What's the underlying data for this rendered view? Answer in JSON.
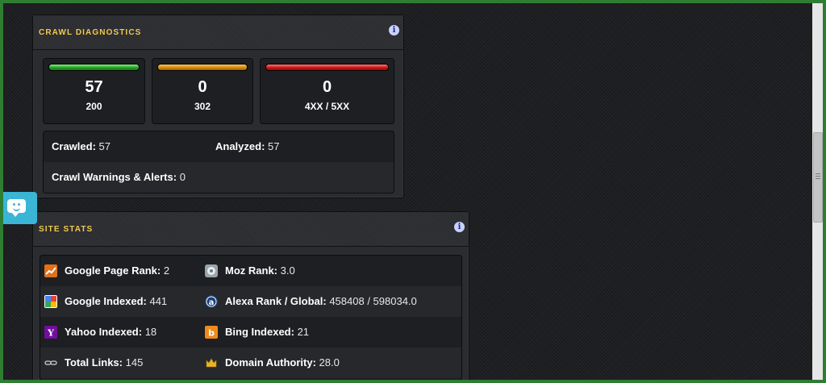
{
  "crawl_diagnostics": {
    "title": "CRAWL DIAGNOSTICS",
    "info_glyph": "i",
    "status_cards": [
      {
        "count": "57",
        "label": "200",
        "bar_color": "#22a322"
      },
      {
        "count": "0",
        "label": "302",
        "bar_color": "#d38a0a"
      },
      {
        "count": "0",
        "label": "4XX / 5XX",
        "bar_color": "#d01515"
      }
    ],
    "summary": {
      "crawled_label": "Crawled:",
      "crawled_value": "57",
      "analyzed_label": "Analyzed:",
      "analyzed_value": "57",
      "warnings_label": "Crawl Warnings & Alerts:",
      "warnings_value": "0"
    }
  },
  "site_stats": {
    "title": "SITE STATS",
    "info_glyph": "i",
    "rows": [
      {
        "left": {
          "icon": "chart-trend-icon",
          "label": "Google Page Rank:",
          "value": "2"
        },
        "right": {
          "icon": "moz-icon",
          "label": "Moz Rank:",
          "value": "3.0"
        }
      },
      {
        "left": {
          "icon": "google-icon",
          "label": "Google Indexed:",
          "value": "441"
        },
        "right": {
          "icon": "alexa-icon",
          "label": "Alexa Rank / Global:",
          "value": "458408 / 598034.0"
        }
      },
      {
        "left": {
          "icon": "yahoo-icon",
          "label": "Yahoo Indexed:",
          "value": "18"
        },
        "right": {
          "icon": "bing-icon",
          "label": "Bing Indexed:",
          "value": "21"
        }
      },
      {
        "left": {
          "icon": "link-icon",
          "label": "Total Links:",
          "value": "145"
        },
        "right": {
          "icon": "crown-icon",
          "label": "Domain Authority:",
          "value": "28.0"
        }
      }
    ]
  },
  "colors": {
    "accent_title": "#f2c94c",
    "chat_button": "#3ab5d6",
    "outer_border": "#2e7d32"
  }
}
